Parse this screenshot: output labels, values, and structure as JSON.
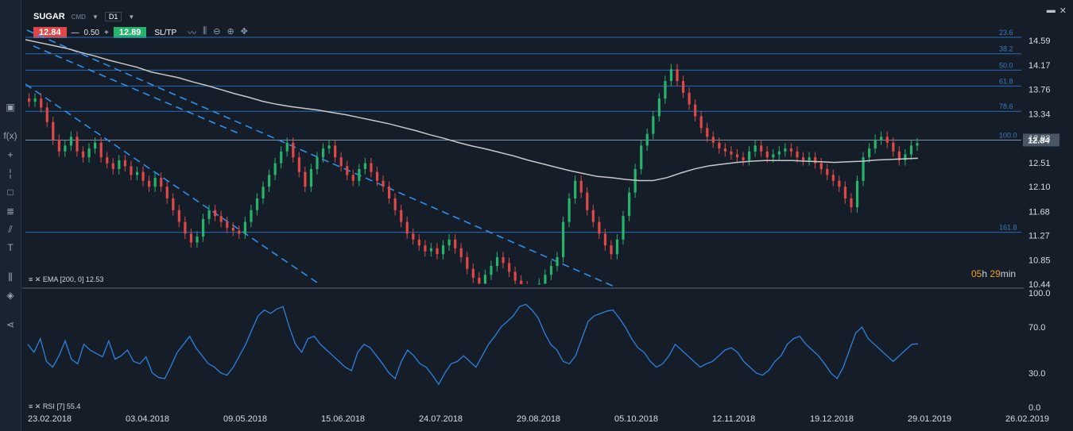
{
  "header": {
    "symbol": "SUGAR",
    "type": "CMD",
    "timeframe": "D1"
  },
  "trade": {
    "sell_price": "12.84",
    "minus": "—",
    "quantity": "0.50",
    "plus": "+",
    "buy_price": "12.89",
    "sltp": "SL/TP"
  },
  "price_axis": [
    "14.59",
    "14.17",
    "13.76",
    "13.34",
    "12.93",
    "12.51",
    "12.10",
    "11.68",
    "11.27",
    "10.85",
    "10.44"
  ],
  "current_price": "12.84",
  "fib_labels": [
    "23.6",
    "38.2",
    "50.0",
    "61.8",
    "78.6",
    "100.0",
    "161.8"
  ],
  "rsi_axis": [
    "100.0",
    "70.0",
    "30.0",
    "0.0"
  ],
  "date_axis": [
    "23.02.2018",
    "03.04.2018",
    "09.05.2018",
    "15.06.2018",
    "24.07.2018",
    "29.08.2018",
    "05.10.2018",
    "12.11.2018",
    "19.12.2018",
    "29.01.2019",
    "26.02.2019"
  ],
  "ema_label": "EMA [200, 0] 12.53",
  "rsi_label": "RSI [7] 55.4",
  "countdown": {
    "hours": "05",
    "h": "h",
    "mins": "29",
    "min": "min"
  },
  "colors": {
    "bg": "#151e28",
    "bull": "#26b36b",
    "bear": "#e04848",
    "fib": "#2a6ab8",
    "trend": "#2f8fe8",
    "ema": "#c8c8c8",
    "rsi": "#2f7fdc",
    "countdown": "#f0a020"
  },
  "chart_data": {
    "type": "candlestick",
    "ylim": [
      10.44,
      14.59
    ],
    "rsi_ylim": [
      0,
      100
    ],
    "closes": [
      13.55,
      13.6,
      13.45,
      13.2,
      12.9,
      12.7,
      12.8,
      12.95,
      12.7,
      12.6,
      12.75,
      12.85,
      12.6,
      12.5,
      12.4,
      12.55,
      12.45,
      12.3,
      12.35,
      12.2,
      12.1,
      12.25,
      12.1,
      11.9,
      11.7,
      11.5,
      11.3,
      11.15,
      11.25,
      11.55,
      11.7,
      11.6,
      11.5,
      11.4,
      11.35,
      11.3,
      11.5,
      11.7,
      11.9,
      12.1,
      12.3,
      12.5,
      12.7,
      12.85,
      12.6,
      12.35,
      12.1,
      12.4,
      12.6,
      12.75,
      12.8,
      12.6,
      12.45,
      12.3,
      12.2,
      12.4,
      12.5,
      12.35,
      12.2,
      12.1,
      11.9,
      11.7,
      11.5,
      11.3,
      11.2,
      11.1,
      11.0,
      11.05,
      10.95,
      11.1,
      11.2,
      11.05,
      10.9,
      10.7,
      10.55,
      10.45,
      10.6,
      10.75,
      10.9,
      10.8,
      10.65,
      10.5,
      10.4,
      10.35,
      10.3,
      10.45,
      10.6,
      10.75,
      10.9,
      11.5,
      11.9,
      12.2,
      12.0,
      11.7,
      11.5,
      11.3,
      11.1,
      10.95,
      11.2,
      11.6,
      12.0,
      12.4,
      12.8,
      13.0,
      13.3,
      13.6,
      13.9,
      14.1,
      13.9,
      13.7,
      13.5,
      13.3,
      13.1,
      12.95,
      12.85,
      12.75,
      12.7,
      12.65,
      12.6,
      12.55,
      12.7,
      12.8,
      12.7,
      12.6,
      12.65,
      12.7,
      12.75,
      12.7,
      12.6,
      12.55,
      12.6,
      12.5,
      12.4,
      12.3,
      12.2,
      12.1,
      11.9,
      11.75,
      12.2,
      12.6,
      12.75,
      12.9,
      12.95,
      12.85,
      12.7,
      12.55,
      12.65,
      12.8,
      12.84
    ],
    "rsi": [
      55,
      48,
      60,
      40,
      35,
      45,
      58,
      42,
      38,
      55,
      50,
      47,
      44,
      58,
      42,
      45,
      50,
      40,
      38,
      44,
      30,
      26,
      25,
      36,
      48,
      55,
      62,
      52,
      45,
      38,
      35,
      30,
      28,
      35,
      45,
      55,
      68,
      80,
      85,
      82,
      86,
      88,
      70,
      55,
      48,
      60,
      62,
      55,
      50,
      45,
      40,
      35,
      32,
      48,
      55,
      52,
      45,
      38,
      30,
      25,
      40,
      50,
      45,
      38,
      35,
      28,
      20,
      30,
      38,
      40,
      45,
      40,
      35,
      45,
      55,
      62,
      70,
      75,
      80,
      88,
      90,
      85,
      78,
      65,
      55,
      50,
      40,
      38,
      45,
      60,
      75,
      80,
      82,
      84,
      85,
      78,
      70,
      60,
      52,
      48,
      40,
      35,
      38,
      45,
      55,
      50,
      45,
      40,
      35,
      38,
      40,
      45,
      50,
      52,
      48,
      40,
      35,
      30,
      28,
      32,
      40,
      45,
      55,
      60,
      62,
      55,
      50,
      45,
      38,
      30,
      25,
      35,
      50,
      65,
      70,
      60,
      55,
      50,
      45,
      40,
      45,
      50,
      55,
      55.4
    ],
    "ema": [
      14.55,
      14.5,
      14.45,
      14.4,
      14.33,
      14.27,
      14.2,
      14.14,
      14.08,
      14.0,
      13.95,
      13.9,
      13.83,
      13.77,
      13.7,
      13.63,
      13.57,
      13.5,
      13.45,
      13.41,
      13.38,
      13.35,
      13.31,
      13.27,
      13.22,
      13.17,
      13.12,
      13.06,
      13.0,
      12.93,
      12.87,
      12.8,
      12.74,
      12.69,
      12.63,
      12.57,
      12.5,
      12.44,
      12.38,
      12.32,
      12.27,
      12.22,
      12.2,
      12.17,
      12.15,
      12.15,
      12.2,
      12.28,
      12.35,
      12.4,
      12.43,
      12.46,
      12.48,
      12.49,
      12.49,
      12.49,
      12.48,
      12.47,
      12.46,
      12.47,
      12.48,
      12.5,
      12.51,
      12.52,
      12.53
    ]
  }
}
